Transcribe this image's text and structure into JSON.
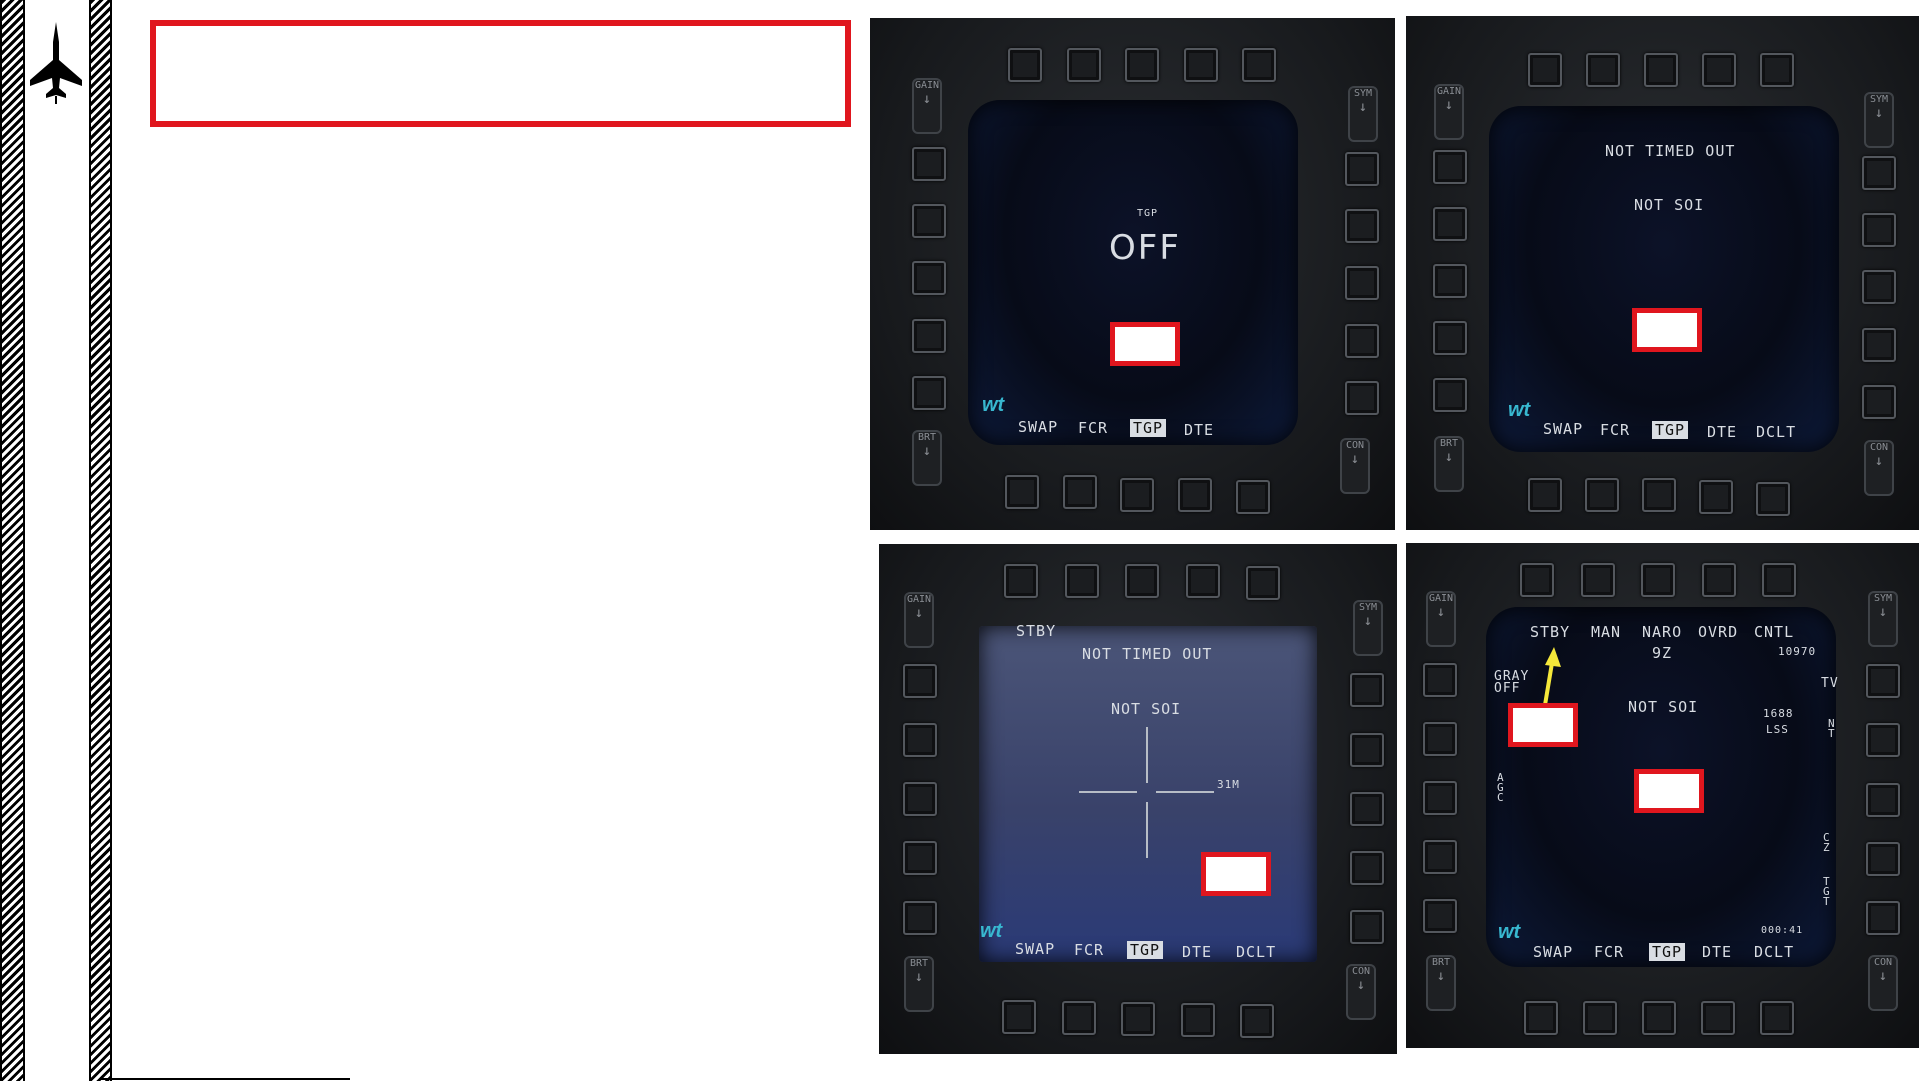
{
  "sidebar": {
    "icon": "fighter-jet-icon"
  },
  "title": {
    "text": ""
  },
  "mfd1": {
    "label": "TGP",
    "status": "OFF",
    "osb_labels": [
      "SWAP",
      "FCR",
      "TGP",
      "DTE"
    ]
  },
  "mfd2": {
    "line1": "NOT TIMED OUT",
    "line2": "NOT SOI",
    "osb_labels": [
      "SWAP",
      "FCR",
      "TGP",
      "DTE",
      "DCLT"
    ]
  },
  "mfd3": {
    "mode": "STBY",
    "line1": "NOT TIMED OUT",
    "line2": "NOT SOI",
    "range": "31M",
    "osb_labels": [
      "SWAP",
      "FCR",
      "TGP",
      "DTE",
      "DCLT"
    ]
  },
  "mfd4": {
    "top_labels": [
      "STBY",
      "MAN",
      "NARO",
      "OVRD",
      "CNTL"
    ],
    "fov": "9Z",
    "altitude": "10970",
    "gray_line1": "GRAY",
    "gray_line2": "OFF",
    "sensor": "TV",
    "line2": "NOT SOI",
    "laser_code": "1688",
    "laser": "LSS",
    "nt": "N\nT",
    "agc": "A\nG\nC",
    "cz": "C\nZ",
    "tgt": "T\nG\nT",
    "timer": "000:41",
    "osb_labels": [
      "SWAP",
      "FCR",
      "TGP",
      "DTE",
      "DCLT"
    ]
  },
  "rockers": {
    "gain": "GAIN",
    "sym": "SYM",
    "brt": "BRT",
    "con": "CON"
  },
  "colors": {
    "red_highlight": "#e0161e",
    "arrow": "#f5e83a",
    "logo": "#38b8d0"
  }
}
